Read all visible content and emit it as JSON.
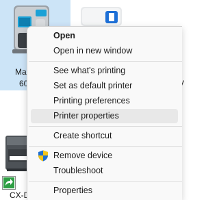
{
  "devices": {
    "selected": {
      "label_line1": "Ma",
      "label_line2": "60"
    },
    "right_partial": {
      "label_line1": "r",
      "label_line2": "V"
    },
    "bottom_left": {
      "label": "CX-D"
    }
  },
  "context_menu": {
    "items": [
      {
        "label": "Open",
        "bold": true
      },
      {
        "label": "Open in new window"
      },
      {
        "label": "See what's printing"
      },
      {
        "label": "Set as default printer"
      },
      {
        "label": "Printing preferences"
      },
      {
        "label": "Printer properties",
        "highlighted": true
      },
      {
        "label": "Create shortcut"
      },
      {
        "label": "Remove device",
        "icon": "uac-shield-icon"
      },
      {
        "label": "Troubleshoot"
      },
      {
        "label": "Properties"
      }
    ]
  },
  "colors": {
    "selection": "#cce4f7",
    "menu_bg": "#f9f9f9",
    "hover": "#e8e8e8",
    "shield_blue": "#1f6fd1",
    "shield_yellow": "#f5c518"
  }
}
